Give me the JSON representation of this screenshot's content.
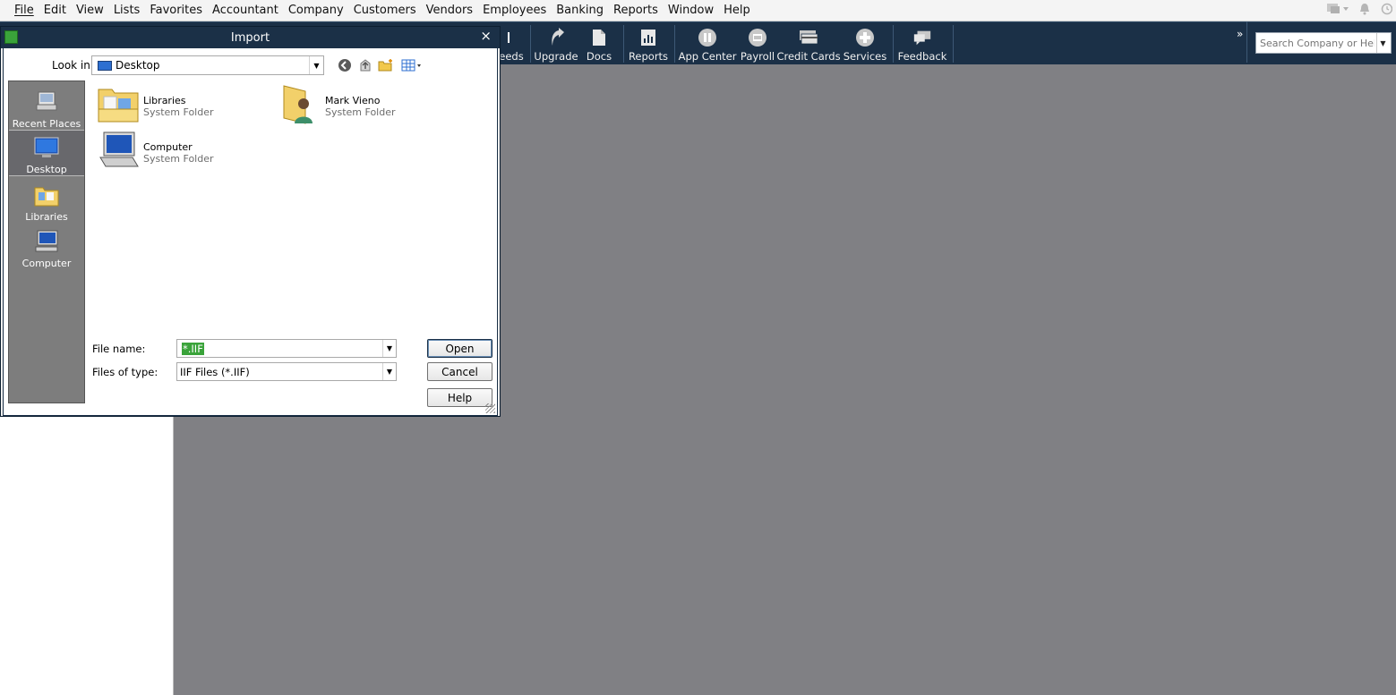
{
  "menubar": {
    "items": [
      "File",
      "Edit",
      "View",
      "Lists",
      "Favorites",
      "Accountant",
      "Company",
      "Customers",
      "Vendors",
      "Employees",
      "Banking",
      "Reports",
      "Window",
      "Help"
    ],
    "right_icons": [
      "chat-icon",
      "bell-icon",
      "clock-icon"
    ]
  },
  "toolbar": {
    "partial_label": "eeds",
    "buttons": [
      {
        "label": "Upgrade",
        "icon": "upgrade-arrow-icon"
      },
      {
        "label": "Docs",
        "icon": "document-icon"
      },
      {
        "label": "Reports",
        "icon": "report-chart-icon"
      },
      {
        "label": "App Center",
        "icon": "app-center-icon"
      },
      {
        "label": "Payroll",
        "icon": "payroll-icon"
      },
      {
        "label": "Credit Cards",
        "icon": "credit-card-icon"
      },
      {
        "label": "Services",
        "icon": "plus-circle-icon"
      },
      {
        "label": "Feedback",
        "icon": "feedback-bubble-icon"
      }
    ],
    "more": "»",
    "search": {
      "placeholder": "Search Company or Help"
    }
  },
  "dialog": {
    "title": "Import",
    "close": "×",
    "look_in_label": "Look in:",
    "look_in_value": "Desktop",
    "places": [
      {
        "label": "Recent Places",
        "icon": "recent-places-icon"
      },
      {
        "label": "Desktop",
        "icon": "desktop-icon",
        "selected": true
      },
      {
        "label": "Libraries",
        "icon": "libraries-icon"
      },
      {
        "label": "Computer",
        "icon": "computer-icon"
      }
    ],
    "files": [
      {
        "name": "Libraries",
        "type": "System Folder",
        "icon": "libraries-folder-icon"
      },
      {
        "name": "Mark Vieno",
        "type": "System Folder",
        "icon": "user-folder-icon"
      },
      {
        "name": "Computer",
        "type": "System Folder",
        "icon": "computer-icon"
      }
    ],
    "file_name_label": "File name:",
    "file_name_value": "*.IIF",
    "file_type_label": "Files of type:",
    "file_type_value": "IIF Files (*.IIF)",
    "buttons": {
      "open": "Open",
      "cancel": "Cancel",
      "help": "Help"
    }
  },
  "colors": {
    "toolbar_bg": "#1b3047",
    "workspace_bg": "#808084",
    "selection_green": "#3aa33a"
  }
}
